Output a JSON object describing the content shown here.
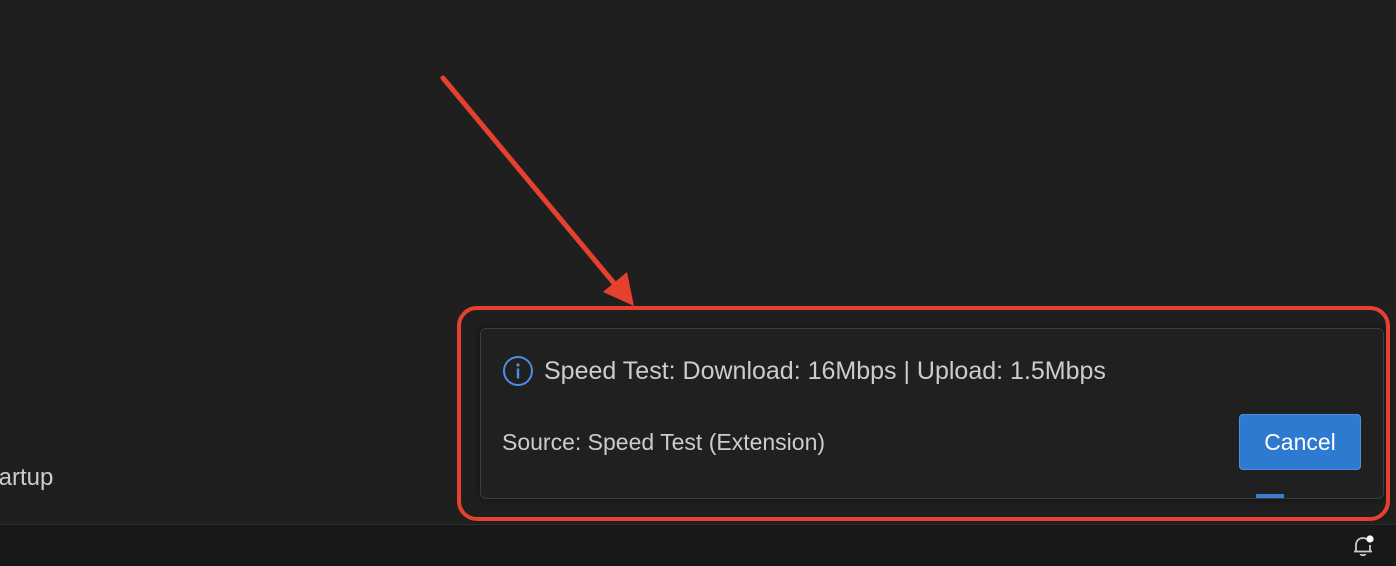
{
  "editor": {
    "partial_text": "tartup"
  },
  "notification": {
    "icon": "info-icon",
    "message": "Speed Test: Download: 16Mbps | Upload: 1.5Mbps",
    "source": "Source: Speed Test (Extension)",
    "cancel_label": "Cancel"
  },
  "status_bar": {
    "notifications_icon": "bell-dot-icon"
  },
  "colors": {
    "background": "#1f1f1f",
    "accent": "#2f7ad1",
    "annotation": "#e5412e",
    "info": "#4a90e2"
  }
}
